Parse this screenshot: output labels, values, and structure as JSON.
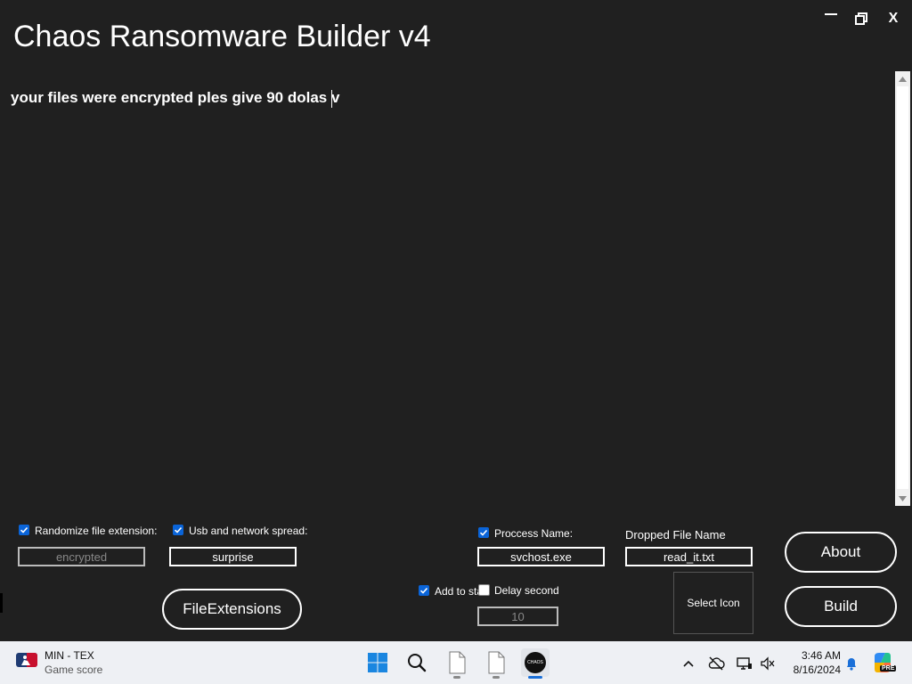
{
  "window": {
    "title": "Chaos Ransomware Builder v4",
    "minimize": "—",
    "close": "X"
  },
  "note": {
    "text": "your files were encrypted ples give 90 dolas v"
  },
  "options": {
    "randomize_label": "Randomize file extension:",
    "randomize_checked": true,
    "randomize_value": "encrypted",
    "usb_label": "Usb and network spread:",
    "usb_checked": true,
    "usb_value": "surprise",
    "process_label": "Proccess Name:",
    "process_checked": true,
    "process_value": "svchost.exe",
    "dropped_label": "Dropped File Name",
    "dropped_value": "read_it.txt",
    "startup_label": "Add to sta",
    "startup_checked": true,
    "delay_label": "Delay second",
    "delay_checked": false,
    "delay_value": "10"
  },
  "buttons": {
    "file_extensions": "FileExtensions",
    "select_icon": "Select Icon",
    "about": "About",
    "build": "Build"
  },
  "taskbar": {
    "widget_title": "MIN - TEX",
    "widget_subtitle": "Game score",
    "clock_time": "3:46 AM",
    "clock_date": "8/16/2024",
    "app_icon_text": "CHAOS",
    "copilot_badge": "PRE",
    "icons": [
      "mlb-logo-icon",
      "windows-start-icon",
      "search-icon",
      "file-icon",
      "file-icon",
      "chaos-app-icon",
      "chevron-up-icon",
      "cloud-off-icon",
      "display-icon",
      "speaker-muted-icon",
      "bell-icon",
      "copilot-icon"
    ]
  }
}
